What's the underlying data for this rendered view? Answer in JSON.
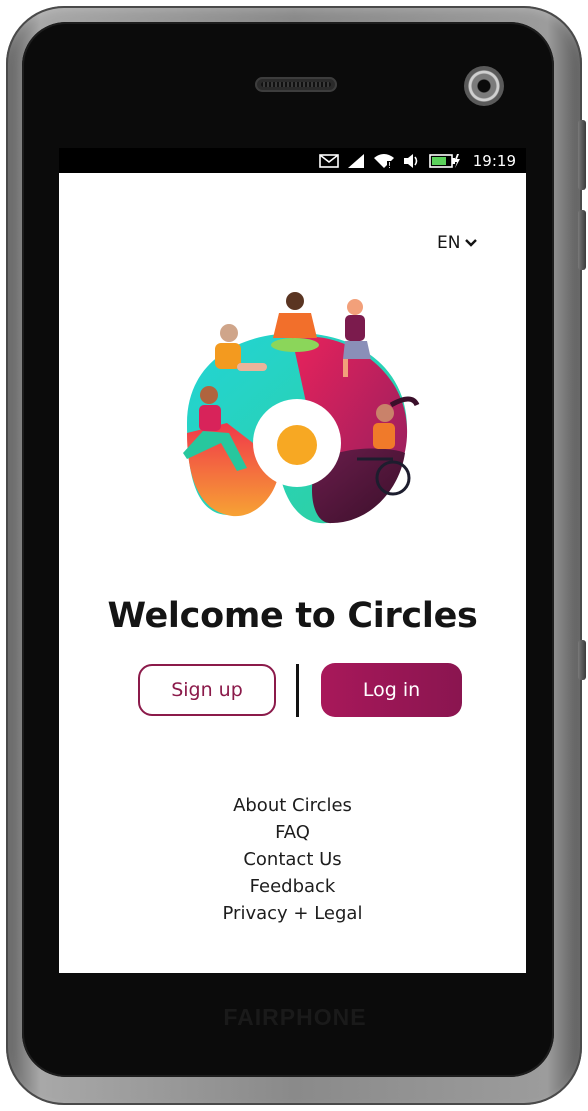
{
  "device": {
    "brand_label": "FAIRPHONE"
  },
  "status_bar": {
    "time": "19:19",
    "icons": [
      "mail-icon",
      "signal-icon",
      "wifi-icon",
      "volume-icon",
      "battery-charging-icon"
    ]
  },
  "language": {
    "selected": "EN",
    "icon": "chevron-down-icon"
  },
  "hero": {
    "illustration": "circles-logo-with-people-illustration",
    "colors": [
      "#2ed3c6",
      "#e8225c",
      "#f26f2b",
      "#5b1f3e",
      "#f5a623"
    ]
  },
  "welcome": {
    "title": "Welcome to Circles"
  },
  "actions": {
    "signup_label": "Sign up",
    "login_label": "Log in",
    "accent_color": "#8b1a4a"
  },
  "footer": {
    "links": [
      "About Circles",
      "FAQ",
      "Contact Us",
      "Feedback",
      "Privacy + Legal"
    ]
  }
}
